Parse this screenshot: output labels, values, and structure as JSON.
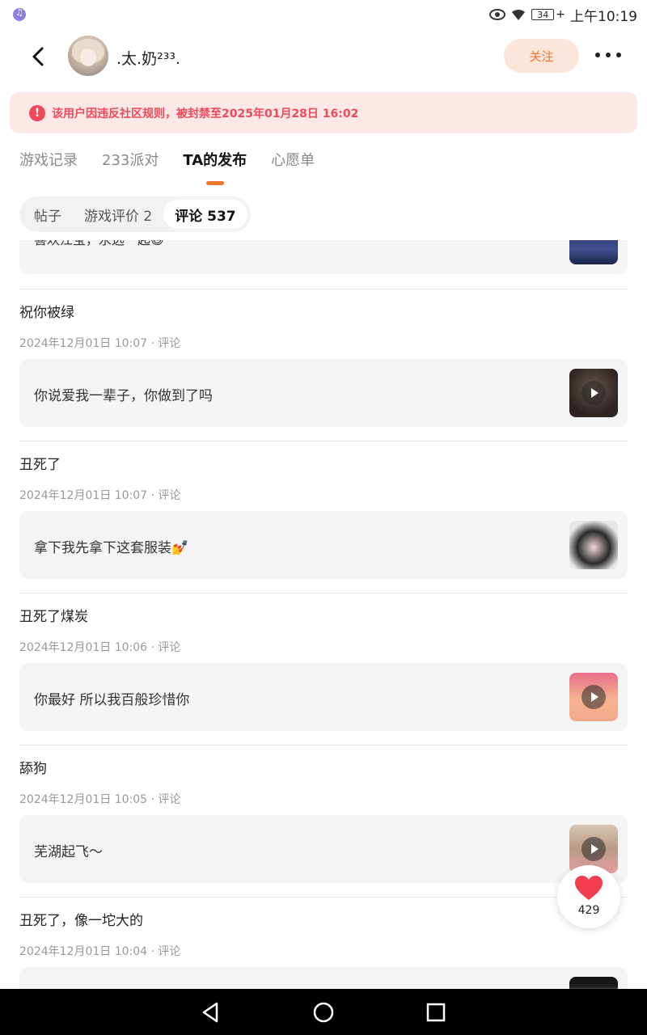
{
  "status_bar": {
    "battery": "34",
    "time": "上午10:19"
  },
  "header": {
    "user_name": ".太.奶²³³.",
    "follow_label": "关注"
  },
  "ban_banner": {
    "text": "该用户因违反社区规则，被封禁至2025年01月28日 16:02"
  },
  "main_tabs": [
    {
      "label": "游戏记录"
    },
    {
      "label": "233派对"
    },
    {
      "label": "TA的发布"
    },
    {
      "label": "心愿单"
    }
  ],
  "sub_tabs": [
    {
      "label": "帖子"
    },
    {
      "label": "游戏评价 2"
    },
    {
      "label": "评论 537"
    }
  ],
  "feed": {
    "partial_text": "喜欢江宝，永远一起😆",
    "items": [
      {
        "title": "祝你被绿",
        "meta": "2024年12月01日 10:07 · 评论",
        "card_text": "你说爱我一辈子，你做到了吗",
        "thumb_color": "#2b2421"
      },
      {
        "title": "丑死了",
        "meta": "2024年12月01日 10:07 · 评论",
        "card_text": "拿下我先拿下这套服装💅",
        "thumb_color": "#e6e6e6"
      },
      {
        "title": "丑死了煤炭",
        "meta": "2024年12月01日 10:06 · 评论",
        "card_text": "你最好 所以我百般珍惜你",
        "thumb_color": "#f3a98b"
      },
      {
        "title": "舔狗",
        "meta": "2024年12月01日 10:05 · 评论",
        "card_text": "芜湖起飞～",
        "thumb_color": "#b89a82"
      },
      {
        "title": "丑死了，像一坨大的",
        "meta": "2024年12月01日 10:04 · 评论",
        "card_text": "",
        "thumb_color": "#1c1c1c"
      }
    ]
  },
  "like_fab": {
    "count": "429",
    "color": "#f23d4f"
  }
}
